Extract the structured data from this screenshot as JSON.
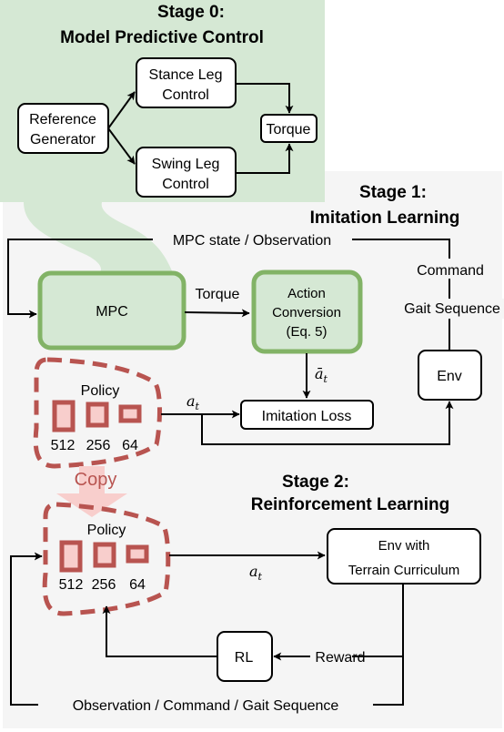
{
  "colors": {
    "stage0_bg": "#d5e8d4",
    "stage_bg": "#f5f5f5",
    "green_border": "#82b366",
    "green_fill": "#d5e8d4",
    "policy_red": "#b85450",
    "policy_fill": "#f8cecc"
  },
  "stage0": {
    "title_line1": "Stage 0:",
    "title_line2": "Model Predictive Control",
    "reference_generator": [
      "Reference",
      "Generator"
    ],
    "stance_leg": [
      "Stance Leg",
      "Control"
    ],
    "swing_leg": [
      "Swing Leg",
      "Control"
    ],
    "torque": "Torque"
  },
  "stage1": {
    "title_line1": "Stage 1:",
    "title_line2": "Imitation Learning",
    "mpc_state_label": "MPC state / Observation",
    "command_label": "Command",
    "gait_label": "Gait Sequence",
    "mpc": "MPC",
    "torque_edge": "Torque",
    "action_conversion": [
      "Action",
      "Conversion",
      "(Eq. 5)"
    ],
    "abar_t": "ā",
    "abar_sub": "t",
    "a_t": "a",
    "a_sub": "t",
    "imitation_loss": "Imitation Loss",
    "env": "Env",
    "policy_title": "Policy",
    "layers": [
      "512",
      "256",
      "64"
    ]
  },
  "copy_label": "Copy",
  "stage2": {
    "title_line1": "Stage 2:",
    "title_line2": "Reinforcement Learning",
    "policy_title": "Policy",
    "layers": [
      "512",
      "256",
      "64"
    ],
    "a_t": "a",
    "a_sub": "t",
    "env_terrain": [
      "Env with",
      "Terrain Curriculum"
    ],
    "rl": "RL",
    "reward": "Reward",
    "feedback_label": "Observation / Command / Gait Sequence"
  }
}
